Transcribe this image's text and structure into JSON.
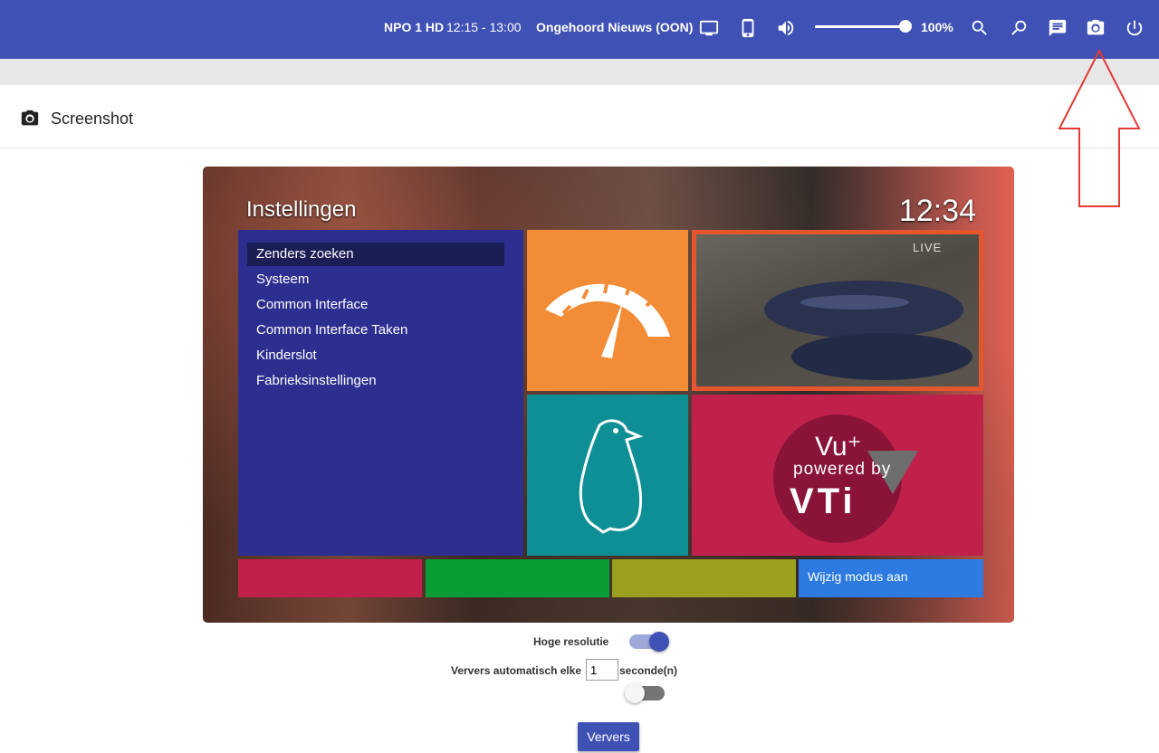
{
  "topbar": {
    "channel": "NPO 1 HD",
    "time": "12:15 - 13:00",
    "program": "Ongehoord Nieuws (OON)",
    "volume": "100%",
    "volume_level": 1.0,
    "icons": [
      "tv-icon",
      "phone-icon",
      "volume-icon",
      "search-icon",
      "search-history-icon",
      "message-icon",
      "camera-icon",
      "power-icon"
    ]
  },
  "page": {
    "title": "Screenshot",
    "icon": "camera-icon"
  },
  "screenshot": {
    "title": "Instellingen",
    "clock": "12:34",
    "live": "LIVE",
    "menu_items": [
      "Zenders zoeken",
      "Systeem",
      "Common Interface",
      "Common Interface Taken",
      "Kinderslot",
      "Fabrieksinstellingen"
    ],
    "selected_index": 0,
    "logo": {
      "line1": "Vu⁺",
      "line2": "powered by",
      "line3": "VTi"
    },
    "color_buttons": {
      "red": "",
      "green": "",
      "yellow": "",
      "blue": "Wijzig modus aan"
    },
    "colors": {
      "menu": "#2c2f8f",
      "orange": "#f28c36",
      "teal": "#0e8f95",
      "red": "#c0214b",
      "green": "#0a9c35",
      "yellow": "#9aa11f",
      "blue": "#2d7be0"
    }
  },
  "controls": {
    "high_res_label": "Hoge resolutie",
    "high_res_on": true,
    "auto_refresh_label": "Ververs automatisch elke",
    "interval_value": "1",
    "interval_unit": "seconde(n)",
    "auto_refresh_on": false,
    "refresh_button": "Ververs"
  },
  "colors": {
    "primary": "#3f51b5",
    "annotation": "#e53935"
  }
}
